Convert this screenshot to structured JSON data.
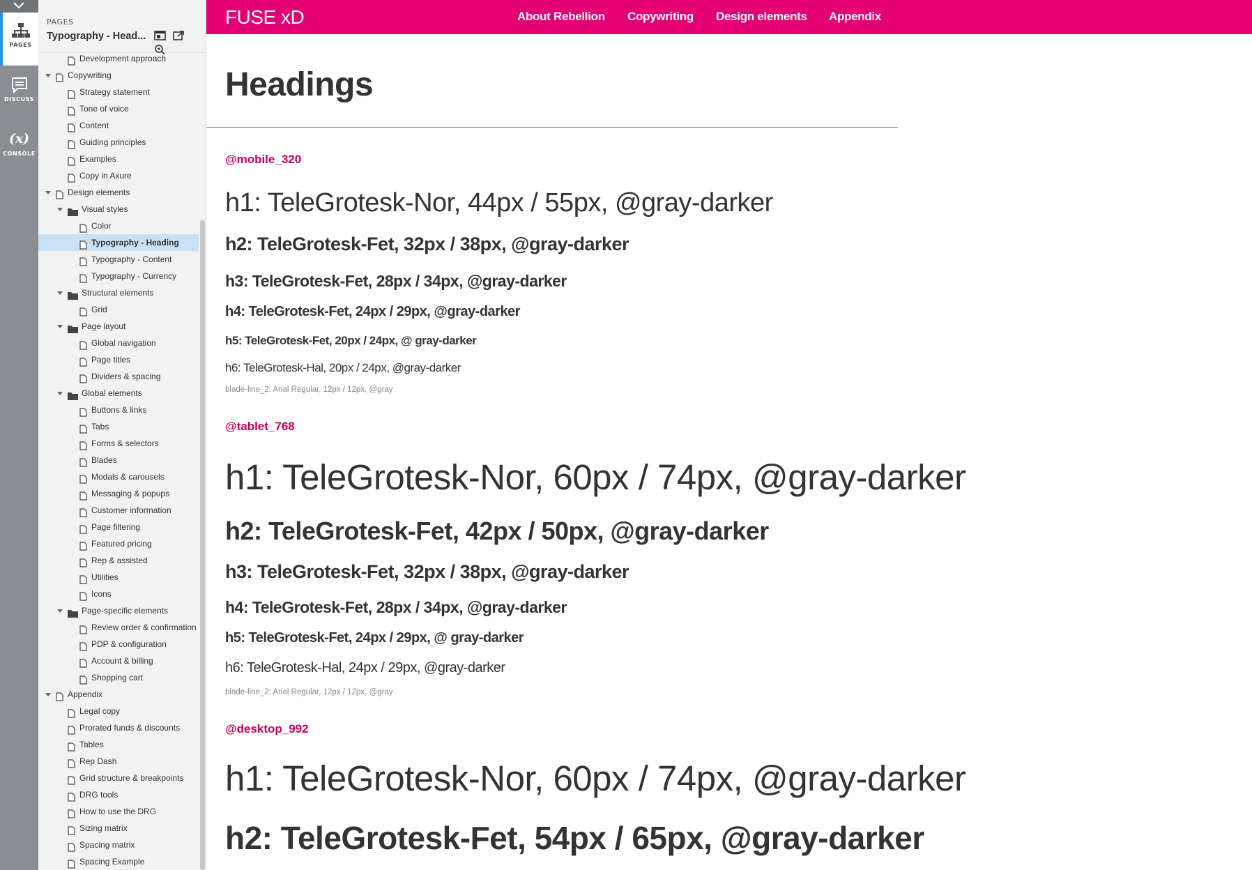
{
  "rail": {
    "pages_label": "PAGES",
    "discuss_label": "DISCUSS",
    "console_label": "CONSOLE",
    "console_glyph": "(x)",
    "accent": "#2d8ee6"
  },
  "sidebar": {
    "section_label": "PAGES",
    "page_title": "Typography - Head...",
    "tools": [
      "single-page-icon",
      "open-in-tab-icon",
      "map-pin-icon"
    ],
    "items": [
      {
        "label": "Development approach",
        "level": 2,
        "type": "page",
        "expanded": null
      },
      {
        "label": "Copywriting",
        "level": 1,
        "type": "page",
        "expanded": true
      },
      {
        "label": "Strategy statement",
        "level": 2,
        "type": "page",
        "expanded": null
      },
      {
        "label": "Tone of voice",
        "level": 2,
        "type": "page",
        "expanded": null
      },
      {
        "label": "Content",
        "level": 2,
        "type": "page",
        "expanded": null
      },
      {
        "label": "Guiding principles",
        "level": 2,
        "type": "page",
        "expanded": null
      },
      {
        "label": "Examples",
        "level": 2,
        "type": "page",
        "expanded": null
      },
      {
        "label": "Copy in Axure",
        "level": 2,
        "type": "page",
        "expanded": null
      },
      {
        "label": "Design elements",
        "level": 1,
        "type": "page",
        "expanded": true
      },
      {
        "label": "Visual styles",
        "level": 2,
        "type": "folder",
        "expanded": true
      },
      {
        "label": "Color",
        "level": 3,
        "type": "page",
        "expanded": null
      },
      {
        "label": "Typography - Heading",
        "level": 3,
        "type": "page",
        "expanded": null,
        "selected": true
      },
      {
        "label": "Typography - Content",
        "level": 3,
        "type": "page",
        "expanded": null
      },
      {
        "label": "Typography - Currency",
        "level": 3,
        "type": "page",
        "expanded": null
      },
      {
        "label": "Structural elements",
        "level": 2,
        "type": "folder",
        "expanded": true
      },
      {
        "label": "Grid",
        "level": 3,
        "type": "page",
        "expanded": null
      },
      {
        "label": "Page layout",
        "level": 2,
        "type": "folder",
        "expanded": true
      },
      {
        "label": "Global navigation",
        "level": 3,
        "type": "page",
        "expanded": null
      },
      {
        "label": "Page titles",
        "level": 3,
        "type": "page",
        "expanded": null
      },
      {
        "label": "Dividers & spacing",
        "level": 3,
        "type": "page",
        "expanded": null
      },
      {
        "label": "Global elements",
        "level": 2,
        "type": "folder",
        "expanded": true
      },
      {
        "label": "Buttons & links",
        "level": 3,
        "type": "page",
        "expanded": null
      },
      {
        "label": "Tabs",
        "level": 3,
        "type": "page",
        "expanded": null
      },
      {
        "label": "Forms & selectors",
        "level": 3,
        "type": "page",
        "expanded": null
      },
      {
        "label": "Blades",
        "level": 3,
        "type": "page",
        "expanded": null
      },
      {
        "label": "Modals & carousels",
        "level": 3,
        "type": "page",
        "expanded": null
      },
      {
        "label": "Messaging & popups",
        "level": 3,
        "type": "page",
        "expanded": null
      },
      {
        "label": "Customer information",
        "level": 3,
        "type": "page",
        "expanded": null
      },
      {
        "label": "Page filtering",
        "level": 3,
        "type": "page",
        "expanded": null
      },
      {
        "label": "Featured pricing",
        "level": 3,
        "type": "page",
        "expanded": null
      },
      {
        "label": "Rep & assisted",
        "level": 3,
        "type": "page",
        "expanded": null
      },
      {
        "label": "Utilities",
        "level": 3,
        "type": "page",
        "expanded": null
      },
      {
        "label": "Icons",
        "level": 3,
        "type": "page",
        "expanded": null
      },
      {
        "label": "Page-specific elements",
        "level": 2,
        "type": "folder",
        "expanded": true
      },
      {
        "label": "Review order & confirmation",
        "level": 3,
        "type": "page",
        "expanded": null
      },
      {
        "label": "PDP & configuration",
        "level": 3,
        "type": "page",
        "expanded": null
      },
      {
        "label": "Account & billing",
        "level": 3,
        "type": "page",
        "expanded": null
      },
      {
        "label": "Shopping cart",
        "level": 3,
        "type": "page",
        "expanded": null
      },
      {
        "label": "Appendix",
        "level": 1,
        "type": "page",
        "expanded": true
      },
      {
        "label": "Legal copy",
        "level": 2,
        "type": "page",
        "expanded": null
      },
      {
        "label": "Prorated funds & discounts",
        "level": 2,
        "type": "page",
        "expanded": null
      },
      {
        "label": "Tables",
        "level": 2,
        "type": "page",
        "expanded": null
      },
      {
        "label": "Rep Dash",
        "level": 2,
        "type": "page",
        "expanded": null
      },
      {
        "label": "Grid structure & breakpoints",
        "level": 2,
        "type": "page",
        "expanded": null
      },
      {
        "label": "DRG tools",
        "level": 2,
        "type": "page",
        "expanded": null
      },
      {
        "label": "How to use the DRG",
        "level": 2,
        "type": "page",
        "expanded": null
      },
      {
        "label": "Sizing matrix",
        "level": 2,
        "type": "page",
        "expanded": null
      },
      {
        "label": "Spacing matrix",
        "level": 2,
        "type": "page",
        "expanded": null
      },
      {
        "label": "Spacing Example",
        "level": 2,
        "type": "page",
        "expanded": null
      }
    ]
  },
  "topbar": {
    "brand": "FUSE xD",
    "color": "#e20074",
    "nav": [
      "About Rebellion",
      "Copywriting",
      "Design elements",
      "Appendix"
    ]
  },
  "content": {
    "title": "Headings",
    "accent": "#c2005d",
    "sections": [
      {
        "breakpoint": "@mobile_320",
        "specs": [
          "h1: TeleGrotesk-Nor, 44px / 55px, @gray-darker",
          "h2: TeleGrotesk-Fet, 32px / 38px, @gray-darker",
          "h3: TeleGrotesk-Fet, 28px / 34px, @gray-darker",
          "h4: TeleGrotesk-Fet, 24px / 29px, @gray-darker",
          "h5: TeleGrotesk-Fet, 20px / 24px, @ gray-darker",
          "h6: TeleGrotesk-Hal, 20px / 24px, @gray-darker"
        ],
        "note": "blade-line_2: Arial Regular, 12px / 12px, @gray"
      },
      {
        "breakpoint": "@tablet_768",
        "specs": [
          "h1: TeleGrotesk-Nor, 60px / 74px, @gray-darker",
          "h2: TeleGrotesk-Fet, 42px / 50px, @gray-darker",
          "h3: TeleGrotesk-Fet, 32px / 38px, @gray-darker",
          "h4: TeleGrotesk-Fet, 28px / 34px, @gray-darker",
          "h5: TeleGrotesk-Fet, 24px / 29px, @ gray-darker",
          "h6: TeleGrotesk-Hal, 24px / 29px, @gray-darker"
        ],
        "note": "blade-line_2: Arial Regular, 12px / 12px, @gray"
      },
      {
        "breakpoint": "@desktop_992",
        "specs": [
          "h1: TeleGrotesk-Nor, 60px / 74px, @gray-darker",
          "h2: TeleGrotesk-Fet, 54px / 65px, @gray-darker"
        ]
      }
    ]
  }
}
